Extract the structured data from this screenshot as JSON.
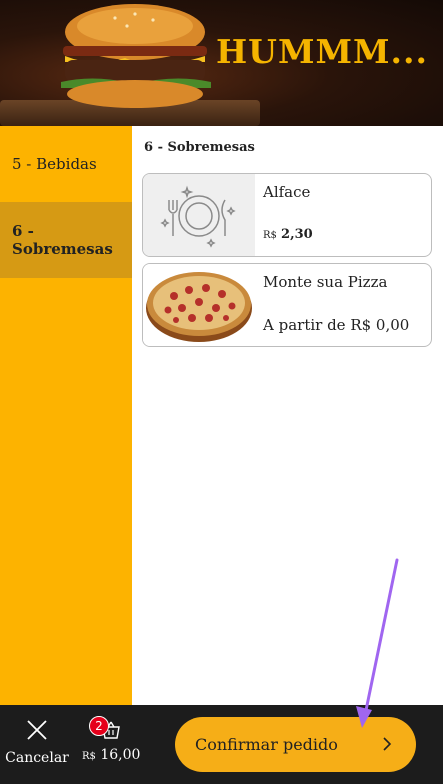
{
  "banner": {
    "title": "HUMMM..."
  },
  "sidebar": {
    "items": [
      {
        "label": "5 - Bebidas",
        "active": false
      },
      {
        "label": "6 - Sobremesas",
        "active": true
      }
    ]
  },
  "main": {
    "section_title": "6 - Sobremesas",
    "products": [
      {
        "name": "Alface",
        "currency": "R$",
        "price": "2,30",
        "icon": "plate-cutlery-icon"
      },
      {
        "name": "Monte sua Pizza",
        "price_text": "A partir de R$ 0,00",
        "icon": "pizza-image"
      }
    ]
  },
  "footer": {
    "cancel_label": "Cancelar",
    "cart_count": "2",
    "cart_currency": "R$",
    "cart_total": "16,00",
    "confirm_label": "Confirmar pedido"
  },
  "colors": {
    "sidebar": "#fdb300",
    "sidebar_active": "#d69a14",
    "confirm_button": "#f6ae17",
    "footer": "#1c1c1c",
    "badge": "#e5001b",
    "annotation_arrow": "#a066f0"
  }
}
